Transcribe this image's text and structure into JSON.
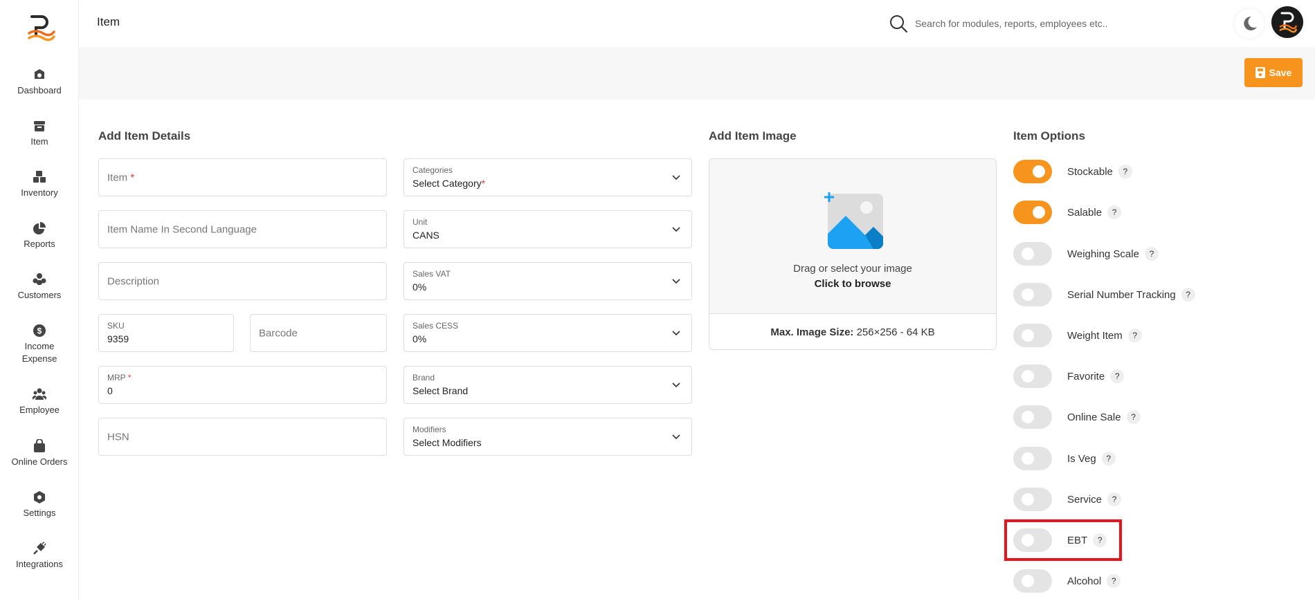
{
  "sidebar": {
    "items": [
      {
        "label": "Dashboard",
        "icon": "dashboard-icon"
      },
      {
        "label": "Item",
        "icon": "item-box-icon"
      },
      {
        "label": "Inventory",
        "icon": "inventory-boxes-icon"
      },
      {
        "label": "Reports",
        "icon": "pie-chart-icon"
      },
      {
        "label": "Customers",
        "icon": "customers-icon"
      },
      {
        "label": "Income\nExpense",
        "icon": "dollar-circle-icon"
      },
      {
        "label": "Employee",
        "icon": "employee-group-icon"
      },
      {
        "label": "Online Orders",
        "icon": "shopping-bag-icon"
      },
      {
        "label": "Settings",
        "icon": "settings-hex-icon"
      },
      {
        "label": "Integrations",
        "icon": "plug-icon"
      }
    ]
  },
  "header": {
    "title": "Item",
    "search_placeholder": "Search for modules, reports, employees etc.."
  },
  "toolbar": {
    "save_label": "Save"
  },
  "details": {
    "title": "Add Item Details",
    "item_placeholder": "Item",
    "required_mark": "*",
    "second_language_placeholder": "Item Name In Second Language",
    "description_placeholder": "Description",
    "sku_label": "SKU",
    "sku_value": "9359",
    "barcode_placeholder": "Barcode",
    "mrp_label": "MRP",
    "mrp_value": "0",
    "hsn_placeholder": "HSN",
    "selects": [
      {
        "label": "Categories",
        "value": "Select Category",
        "required": "*"
      },
      {
        "label": "Unit",
        "value": "CANS"
      },
      {
        "label": "Sales VAT",
        "value": "0%"
      },
      {
        "label": "Sales CESS",
        "value": "0%"
      },
      {
        "label": "Brand",
        "value": "Select Brand"
      },
      {
        "label": "Modifiers",
        "value": "Select Modifiers"
      }
    ]
  },
  "image": {
    "title": "Add Item Image",
    "drag_text": "Drag or select your image",
    "browse_text": "Click to browse",
    "max_label": "Max. Image Size:",
    "max_value": "256×256 - 64 KB"
  },
  "options": {
    "title": "Item Options",
    "help": "?",
    "items": [
      {
        "label": "Stockable",
        "on": true
      },
      {
        "label": "Salable",
        "on": true
      },
      {
        "label": "Weighing Scale",
        "on": false
      },
      {
        "label": "Serial Number Tracking",
        "on": false
      },
      {
        "label": "Weight Item",
        "on": false
      },
      {
        "label": "Favorite",
        "on": false
      },
      {
        "label": "Online Sale",
        "on": false
      },
      {
        "label": "Is Veg",
        "on": false
      },
      {
        "label": "Service",
        "on": false
      },
      {
        "label": "EBT",
        "on": false
      },
      {
        "label": "Alcohol",
        "on": false
      }
    ]
  },
  "colors": {
    "accent": "#f7941d",
    "highlight": "#e8141b"
  }
}
